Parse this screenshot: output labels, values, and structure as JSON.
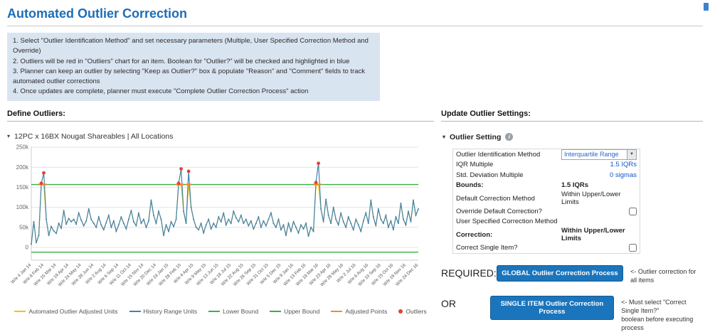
{
  "header": {
    "title": "Automated Outlier Correction"
  },
  "instructions": [
    "1. Select \"Outlier Identification Method\" and set necessary parameters (Multiple, User Specified Correction Method and Override)",
    "2. Outliers will be red in \"Outliers\" chart for an item. Boolean for \"Outlier?\" will be checked and highlighted in blue",
    "3. Planner can keep an outlier by selecting \"Keep as Outlier?\" box & populate \"Reason\" and \"Comment\" fields to track automated outlier corrections",
    "4. Once updates are complete, planner must execute \"Complete Outlier Correction Process\" action"
  ],
  "left": {
    "section_header": "Define Outliers:",
    "item_label": "12PC x 16BX Nougat Shareables | All Locations"
  },
  "chart_data": {
    "type": "line",
    "title": "",
    "xlabel": "",
    "ylabel": "",
    "ylim": [
      -32000,
      252000
    ],
    "grid": true,
    "legend_position": "bottom",
    "yticks": [
      {
        "v": 0,
        "label": "0"
      },
      {
        "v": 50000,
        "label": "50k"
      },
      {
        "v": 100000,
        "label": "100k"
      },
      {
        "v": 150000,
        "label": "150k"
      },
      {
        "v": 200000,
        "label": "200k"
      },
      {
        "v": 250000,
        "label": "250k"
      }
    ],
    "tick_step": 5,
    "tick_labels": [
      "W/e 4 Jan 14",
      "W/e 8 Feb 14",
      "W/e 15 Mar 14",
      "W/e 19 Apr 14",
      "W/e 24 May 14",
      "W/e 28 Jun 14",
      "W/e 2 Aug 14",
      "W/e 6 Sep 14",
      "W/e 11 Oct 14",
      "W/e 15 Nov 14",
      "W/e 20 Dec 14",
      "W/e 24 Jan 15",
      "W/e 28 Feb 15",
      "W/e 4 Apr 15",
      "W/e 9 May 15",
      "W/e 13 Jun 15",
      "W/e 18 Jul 15",
      "W/e 22 Aug 15",
      "W/e 26 Sep 15",
      "W/e 31 Oct 15",
      "W/e 5 Dec 15",
      "W/e 9 Jan 16",
      "W/e 13 Feb 16",
      "W/e 19 Mar 16",
      "W/e 23 Apr 16",
      "W/e 28 May 16",
      "W/e 2 Jul 16",
      "W/e 6 Aug 16",
      "W/e 10 Sep 16",
      "W/e 15 Oct 16",
      "W/e 19 Nov 16",
      "W/e 24 Dec 16"
    ],
    "upper_bound": 157000,
    "lower_bound": -12000,
    "outlier_indices": [
      4,
      5,
      59,
      60,
      63,
      114,
      115
    ],
    "series": [
      {
        "name": "History Range Units",
        "values": [
          8000,
          64000,
          12000,
          30000,
          160000,
          186000,
          70000,
          30000,
          52000,
          41000,
          35000,
          60000,
          48000,
          92000,
          58000,
          72000,
          64000,
          70000,
          58000,
          86000,
          68000,
          54000,
          66000,
          96000,
          70000,
          60000,
          50000,
          76000,
          56000,
          44000,
          62000,
          80000,
          50000,
          66000,
          40000,
          56000,
          76000,
          60000,
          46000,
          70000,
          92000,
          64000,
          54000,
          86000,
          60000,
          70000,
          50000,
          66000,
          118000,
          80000,
          60000,
          90000,
          70000,
          30000,
          56000,
          40000,
          64000,
          52000,
          70000,
          160000,
          196000,
          90000,
          60000,
          190000,
          100000,
          70000,
          50000,
          44000,
          60000,
          36000,
          56000,
          70000,
          46000,
          60000,
          50000,
          76000,
          64000,
          86000,
          56000,
          70000,
          60000,
          90000,
          74000,
          64000,
          80000,
          60000,
          70000,
          54000,
          66000,
          46000,
          60000,
          76000,
          50000,
          66000,
          54000,
          70000,
          86000,
          60000,
          50000,
          70000,
          44000,
          56000,
          30000,
          60000,
          40000,
          64000,
          50000,
          36000,
          56000,
          46000,
          60000,
          28000,
          50000,
          40000,
          162000,
          210000,
          96000,
          64000,
          120000,
          80000,
          60000,
          100000,
          70000,
          56000,
          86000,
          64000,
          50000,
          76000,
          60000,
          44000,
          70000,
          56000,
          40000,
          66000,
          86000,
          60000,
          118000,
          76000,
          54000,
          96000,
          70000,
          60000,
          80000,
          50000,
          66000,
          44000,
          76000,
          60000,
          110000,
          70000,
          56000,
          90000,
          64000,
          118000,
          80000,
          96000
        ]
      }
    ],
    "legend": [
      {
        "label": "Automated Outlier Adjusted Units",
        "color": "#f2c500",
        "type": "line"
      },
      {
        "label": "History Range Units",
        "color": "#4181af",
        "type": "line"
      },
      {
        "label": "Lower Bound",
        "color": "#3cb043",
        "type": "line"
      },
      {
        "label": "Upper Bound",
        "color": "#3cb043",
        "type": "line"
      },
      {
        "label": "Adjusted Points",
        "color": "#f28c28",
        "type": "line"
      },
      {
        "label": "Outliers",
        "color": "#e0442c",
        "type": "dot"
      }
    ]
  },
  "right": {
    "section_header": "Update Outlier Settings:",
    "group_label": "Outlier Setting",
    "settings": [
      {
        "label": "Outlier Identification Method",
        "control": "select",
        "value": "Interquartile Range"
      },
      {
        "label": "IQR Multiple",
        "value": "1.5 IQRs",
        "link": true,
        "align": "right"
      },
      {
        "label": "Std. Deviation Multiple",
        "value": "0 sigmas",
        "link": true,
        "align": "right"
      },
      {
        "label": "Bounds:",
        "value": "1.5 IQRs",
        "bold": true
      },
      {
        "label": "Default Correction Method",
        "value": "Within Upper/Lower Limits"
      },
      {
        "label": "Override Default Correction?",
        "control": "checkbox"
      },
      {
        "label": "User Specified Correction Method",
        "value": ""
      },
      {
        "label": "Correction:",
        "value": "Within Upper/Lower Limits",
        "bold": true
      },
      {
        "label": "Correct Single Item?",
        "control": "checkbox"
      }
    ],
    "actions": [
      {
        "label": "REQUIRED:",
        "button": "GLOBAL Outlier Correction Process",
        "note": "<- Outlier correction for all items"
      },
      {
        "label": "OR",
        "button": "SINGLE ITEM Outlier Correction Process",
        "note": "<- Must select \"Correct Single Item?\"\nboolean before executing process"
      }
    ]
  },
  "colors": {
    "title": "#1e6db6",
    "button": "#1b75bc",
    "link_value": "#1155cc",
    "instructions_bg": "#d9e4f1"
  }
}
